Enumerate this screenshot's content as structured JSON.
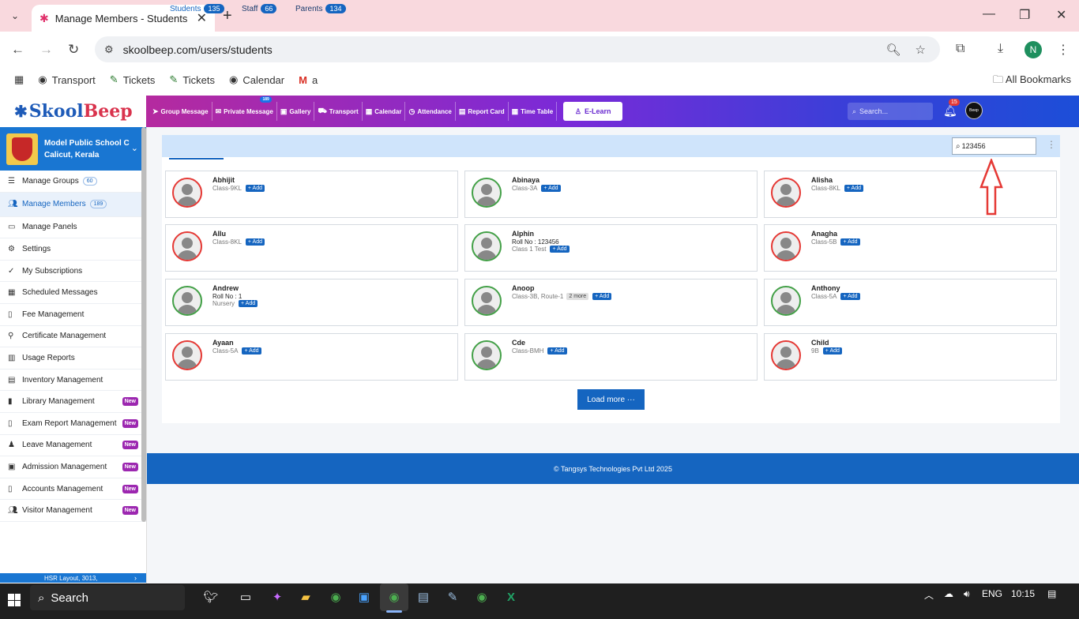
{
  "browser": {
    "tab_title": "Manage Members - Students",
    "url": "skoolbeep.com/users/students",
    "profile_initial": "N",
    "bookmarks": [
      "Transport",
      "Tickets",
      "Tickets",
      "Calendar",
      "a"
    ],
    "all_bookmarks": "All Bookmarks"
  },
  "brand": {
    "logo_part1": "Skool",
    "logo_part2": "Beep"
  },
  "topnav": {
    "items": [
      "Group Message",
      "Private Message",
      "Gallery",
      "Transport",
      "Calendar",
      "Attendance",
      "Report Card",
      "Time Table"
    ],
    "private_badge": "189",
    "elearn": "E-Learn",
    "search_placeholder": "Search...",
    "notif_count": "15",
    "avatar_text": "Beep"
  },
  "school": {
    "name": "Model Public School C",
    "location": "Calicut, Kerala"
  },
  "sidebar": {
    "items": [
      {
        "label": "Manage Groups",
        "count": "60"
      },
      {
        "label": "Manage Members",
        "count": "189"
      },
      {
        "label": "Manage Panels"
      },
      {
        "label": "Settings"
      },
      {
        "label": "My Subscriptions"
      },
      {
        "label": "Scheduled Messages"
      },
      {
        "label": "Fee Management"
      },
      {
        "label": "Certificate Management"
      },
      {
        "label": "Usage Reports"
      },
      {
        "label": "Inventory Management"
      },
      {
        "label": "Library Management",
        "badge": "New"
      },
      {
        "label": "Exam Report Management",
        "badge": "New"
      },
      {
        "label": "Leave Management",
        "badge": "New"
      },
      {
        "label": "Admission Management",
        "badge": "New"
      },
      {
        "label": "Accounts Management",
        "badge": "New"
      },
      {
        "label": "Visitor Management",
        "badge": "New"
      }
    ],
    "footer_text": "HSR Layout, 3013,"
  },
  "tabs": [
    {
      "label": "Students",
      "count": "135"
    },
    {
      "label": "Staff",
      "count": "66"
    },
    {
      "label": "Parents",
      "count": "134"
    }
  ],
  "search": {
    "value": "123456"
  },
  "add_label": "+ Add",
  "members": [
    {
      "name": "Abhijit",
      "line1": "Class-9KL"
    },
    {
      "name": "Abinaya",
      "line1": "Class-3A"
    },
    {
      "name": "Alisha",
      "line1": "Class-8KL"
    },
    {
      "name": "Allu",
      "line1": "Class-8KL"
    },
    {
      "name": "Alphin",
      "roll": "Roll No : 123456",
      "line2": "Class 1 Test"
    },
    {
      "name": "Anagha",
      "line1": "Class-5B"
    },
    {
      "name": "Andrew",
      "roll": "Roll No : 1",
      "line2": "Nursery"
    },
    {
      "name": "Anoop",
      "line1": "Class-3B, Route-1",
      "more": "2 more"
    },
    {
      "name": "Anthony",
      "line1": "Class-5A"
    },
    {
      "name": "Ayaan",
      "line1": "Class-5A"
    },
    {
      "name": "Cde",
      "line1": "Class-BMH"
    },
    {
      "name": "Child",
      "line1": "9B"
    }
  ],
  "load_more": "Load more ···",
  "footer": "© Tangsys Technologies Pvt Ltd 2025",
  "taskbar": {
    "search": "Search",
    "lang": "ENG",
    "time": "10:15"
  },
  "colors": {
    "primary": "#1565c0",
    "red_ring": "#e53935",
    "green_ring": "#43a047",
    "new_badge": "#9c27b0"
  }
}
